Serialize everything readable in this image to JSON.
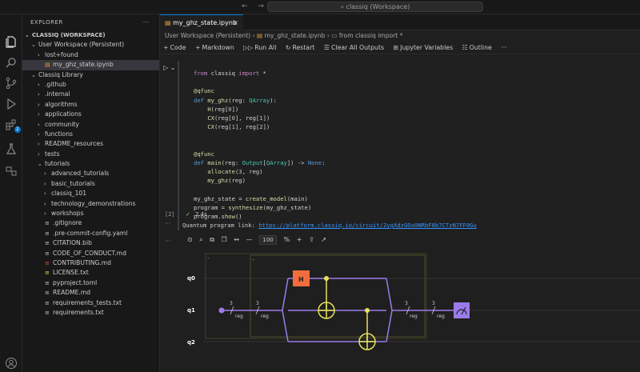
{
  "titlebar": {
    "search_text": "classiq (Workspace)",
    "back": "←",
    "forward": "→"
  },
  "activity": {
    "badge": "2"
  },
  "explorer": {
    "title": "EXPLORER",
    "workspace": "CLASSIQ (WORKSPACE)",
    "items": [
      {
        "label": "User Workspace (Persistent)",
        "depth": 1,
        "type": "folder-open"
      },
      {
        "label": "lost+found",
        "depth": 2,
        "type": "folder"
      },
      {
        "label": "my_ghz_state.ipynb",
        "depth": 2,
        "type": "notebook",
        "selected": true
      },
      {
        "label": "Classiq Library",
        "depth": 1,
        "type": "folder-open"
      },
      {
        "label": ".github",
        "depth": 2,
        "type": "folder"
      },
      {
        "label": ".internal",
        "depth": 2,
        "type": "folder"
      },
      {
        "label": "algorithms",
        "depth": 2,
        "type": "folder"
      },
      {
        "label": "applications",
        "depth": 2,
        "type": "folder"
      },
      {
        "label": "community",
        "depth": 2,
        "type": "folder"
      },
      {
        "label": "functions",
        "depth": 2,
        "type": "folder"
      },
      {
        "label": "README_resources",
        "depth": 2,
        "type": "folder"
      },
      {
        "label": "tests",
        "depth": 2,
        "type": "folder"
      },
      {
        "label": "tutorials",
        "depth": 2,
        "type": "folder-open"
      },
      {
        "label": "advanced_tutorials",
        "depth": 3,
        "type": "folder"
      },
      {
        "label": "basic_tutorials",
        "depth": 3,
        "type": "folder"
      },
      {
        "label": "classiq_101",
        "depth": 3,
        "type": "folder"
      },
      {
        "label": "technology_demonstrations",
        "depth": 3,
        "type": "folder"
      },
      {
        "label": "workshops",
        "depth": 3,
        "type": "folder"
      },
      {
        "label": ".gitignore",
        "depth": 2,
        "type": "file"
      },
      {
        "label": ".pre-commit-config.yaml",
        "depth": 2,
        "type": "file"
      },
      {
        "label": "CITATION.bib",
        "depth": 2,
        "type": "file"
      },
      {
        "label": "CODE_OF_CONDUCT.md",
        "depth": 2,
        "type": "file"
      },
      {
        "label": "CONTRIBUTING.md",
        "depth": 2,
        "type": "file"
      },
      {
        "label": "LICENSE.txt",
        "depth": 2,
        "type": "file"
      },
      {
        "label": "pyproject.toml",
        "depth": 2,
        "type": "file"
      },
      {
        "label": "README.md",
        "depth": 2,
        "type": "file"
      },
      {
        "label": "requirements_tests.txt",
        "depth": 2,
        "type": "file"
      },
      {
        "label": "requirements.txt",
        "depth": 2,
        "type": "file"
      }
    ]
  },
  "tab": {
    "label": "my_ghz_state.ipynb",
    "close": "×"
  },
  "breadcrumb": {
    "a": "User Workspace (Persistent)",
    "b": "my_ghz_state.ipynb",
    "c": "from classiq import *"
  },
  "toolbar": {
    "code": "Code",
    "markdown": "Markdown",
    "run_all": "Run All",
    "restart": "Restart",
    "clear": "Clear All Outputs",
    "variables": "Jupyter Variables",
    "outline": "Outline",
    "more": "···"
  },
  "cell": {
    "exec_count": "[2]",
    "timing": "2.4s",
    "lines": [
      "from classiq import *",
      "",
      "@qfunc",
      "def my_ghz(reg: QArray):",
      "    H(reg[0])",
      "    CX(reg[0], reg[1])",
      "    CX(reg[1], reg[2])",
      "",
      "",
      "@qfunc",
      "def main(reg: Output[QArray]) -> None:",
      "    allocate(3, reg)",
      "    my_ghz(reg)",
      "",
      "my_ghz_state = create_model(main)",
      "program = synthesize(my_ghz_state)",
      "program.show()"
    ]
  },
  "output": {
    "link_label": "Quantum program link:",
    "link_url": "https://platform.classiq.io/circuit/2ygXdzGOx0NRbF8b7CTzN7FF0Gu",
    "zoom": "100",
    "zoom_unit": "%"
  },
  "circuit": {
    "qubits": [
      "q0",
      "q1",
      "q2"
    ],
    "bus_count": "3",
    "bus_label": "reg",
    "gate_h": "H",
    "colors": {
      "h": "#f26d3d",
      "wire": "#9b7bea",
      "cx": "#e8e35a",
      "measure": "#9b7bea"
    }
  }
}
